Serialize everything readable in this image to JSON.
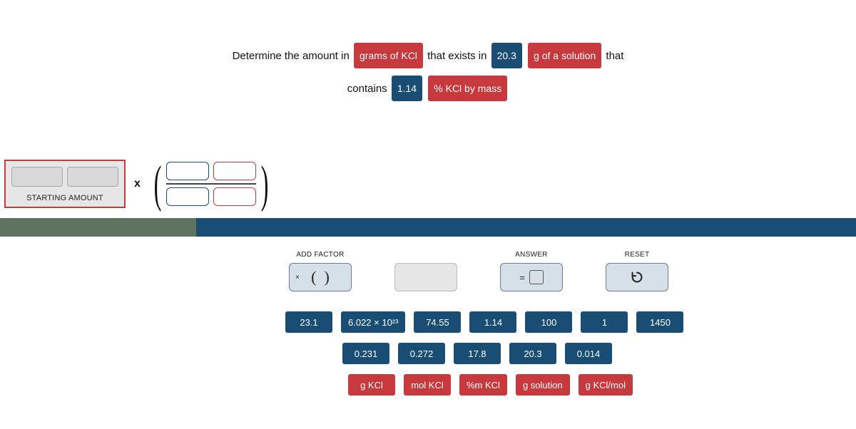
{
  "prompt": {
    "line1_text1": "Determine the amount in",
    "pill1": "grams of KCl",
    "line1_text2": "that exists in",
    "pill2": "20.3",
    "pill3": "g of a solution",
    "line1_text3": "that",
    "line2_text1": "contains",
    "pill4": "1.14",
    "pill5": "% KCl by mass"
  },
  "equation": {
    "starting_amount_label": "STARTING AMOUNT",
    "mult_symbol": "x"
  },
  "panel": {
    "add_factor_label": "ADD FACTOR",
    "add_factor_content": "×(   )",
    "answer_label": "ANSWER",
    "answer_eq": "=",
    "reset_label": "RESET"
  },
  "chips": {
    "row1": [
      "23.1",
      "6.022 × 10²³",
      "74.55",
      "1.14",
      "100",
      "1",
      "1450"
    ],
    "row2": [
      "0.231",
      "0.272",
      "17.8",
      "20.3",
      "0.014"
    ],
    "row3": [
      "g KCl",
      "mol KCl",
      "%m KCl",
      "g solution",
      "g KCl/mol"
    ]
  }
}
